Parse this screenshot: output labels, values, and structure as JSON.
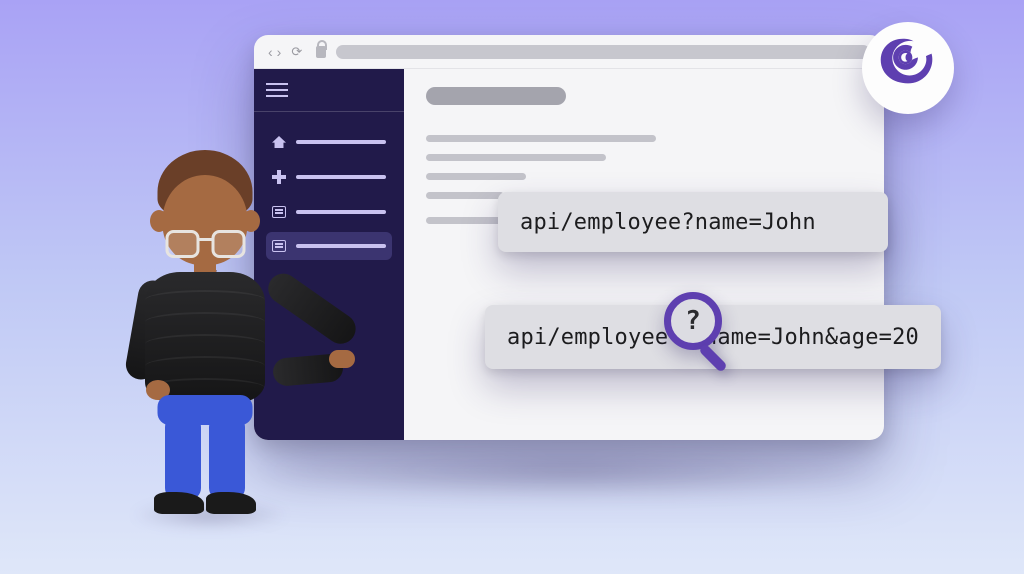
{
  "browser": {
    "nav": {
      "back": "‹",
      "forward": "›",
      "reload": "⟳"
    }
  },
  "sidebar": {
    "items": [
      {
        "icon": "home"
      },
      {
        "icon": "plus"
      },
      {
        "icon": "list"
      },
      {
        "icon": "list",
        "active": true
      }
    ]
  },
  "bubbles": {
    "one": "api/employee?name=John",
    "two_left": "api/employee",
    "two_right": "name=John&age=20",
    "magnifier_char": "?"
  },
  "logo": {
    "name": "blazor"
  }
}
